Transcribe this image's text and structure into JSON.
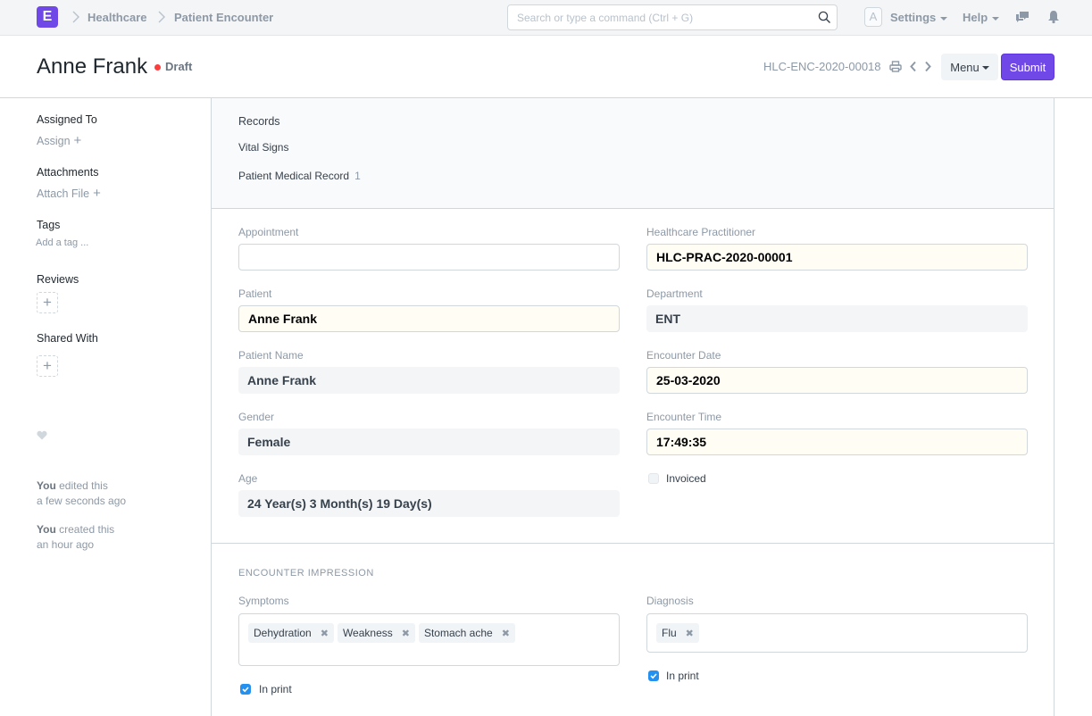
{
  "navbar": {
    "logo_letter": "E",
    "breadcrumbs": [
      "Healthcare",
      "Patient Encounter"
    ],
    "search_placeholder": "Search or type a command (Ctrl + G)",
    "avatar_letter": "A",
    "settings_label": "Settings",
    "help_label": "Help",
    "icons": [
      "chat-icon",
      "bell-icon"
    ]
  },
  "header": {
    "title": "Anne Frank",
    "status": "Draft",
    "status_color": "#ff3d3d",
    "doc_name": "HLC-ENC-2020-00018",
    "menu_label": "Menu",
    "submit_label": "Submit",
    "accent_color": "#7048e8"
  },
  "sidebar": {
    "assigned_to": {
      "heading": "Assigned To",
      "action": "Assign"
    },
    "attachments": {
      "heading": "Attachments",
      "action": "Attach File"
    },
    "tags": {
      "heading": "Tags",
      "action": "Add a tag ..."
    },
    "reviews": {
      "heading": "Reviews"
    },
    "shared_with": {
      "heading": "Shared With"
    },
    "activity": [
      {
        "user": "You",
        "action": "edited this",
        "time": "a few seconds ago"
      },
      {
        "user": "You",
        "action": "created this",
        "time": "an hour ago"
      }
    ]
  },
  "records": {
    "heading": "Records",
    "links": [
      {
        "label": "Vital Signs",
        "count": ""
      },
      {
        "label": "Patient Medical Record",
        "count": "1"
      }
    ]
  },
  "form": {
    "appointment": {
      "label": "Appointment",
      "value": ""
    },
    "patient": {
      "label": "Patient",
      "value": "Anne Frank"
    },
    "patient_name": {
      "label": "Patient Name",
      "value": "Anne Frank"
    },
    "gender": {
      "label": "Gender",
      "value": "Female"
    },
    "age": {
      "label": "Age",
      "value": "24 Year(s) 3 Month(s) 19 Day(s)"
    },
    "practitioner": {
      "label": "Healthcare Practitioner",
      "value": "HLC-PRAC-2020-00001"
    },
    "department": {
      "label": "Department",
      "value": "ENT"
    },
    "encounter_date": {
      "label": "Encounter Date",
      "value": "25-03-2020"
    },
    "encounter_time": {
      "label": "Encounter Time",
      "value": "17:49:35"
    },
    "invoiced": {
      "label": "Invoiced",
      "checked": false
    }
  },
  "impression": {
    "section_title": "ENCOUNTER IMPRESSION",
    "symptoms": {
      "label": "Symptoms",
      "items": [
        "Dehydration",
        "Weakness",
        "Stomach ache"
      ]
    },
    "symptoms_in_print": {
      "label": "In print",
      "checked": true
    },
    "diagnosis": {
      "label": "Diagnosis",
      "items": [
        "Flu"
      ]
    },
    "diagnosis_in_print": {
      "label": "In print",
      "checked": true
    }
  }
}
